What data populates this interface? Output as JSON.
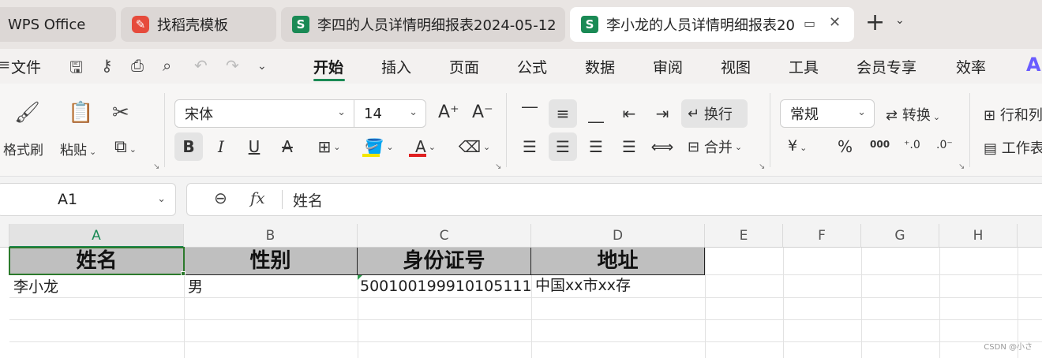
{
  "tabs": [
    {
      "label": "WPS Office",
      "icon": "wps-logo-icon",
      "active": false
    },
    {
      "label": "找稻壳模板",
      "icon": "daoke-icon",
      "active": false
    },
    {
      "label": "李四的人员详情明细报表2024-05-12",
      "icon": "spreadsheet-icon",
      "active": false
    },
    {
      "label": "李小龙的人员详情明细报表20",
      "icon": "spreadsheet-icon",
      "active": true
    }
  ],
  "menu": {
    "file": "文件",
    "items": [
      "开始",
      "插入",
      "页面",
      "公式",
      "数据",
      "审阅",
      "视图",
      "工具",
      "会员专享",
      "效率"
    ],
    "active": "开始"
  },
  "ribbon": {
    "format_painter": "格式刷",
    "paste": "粘贴",
    "font_name": "宋体",
    "font_size": "14",
    "wrap": "换行",
    "merge": "合并",
    "number_format": "常规",
    "convert": "转换",
    "rows_cols": "行和列",
    "worksheet": "工作表",
    "currency_symbol": "¥",
    "percent_symbol": "%",
    "thousands_symbol": "000",
    "font_color": "#e02020",
    "fill_color": "#f2e600",
    "accent": "#1a8a55"
  },
  "formula_bar": {
    "name_box": "A1",
    "fx_label": "fx",
    "value": "姓名"
  },
  "sheet": {
    "columns": [
      "A",
      "B",
      "C",
      "D",
      "E",
      "F",
      "G",
      "H"
    ],
    "header_row": [
      "姓名",
      "性别",
      "身份证号",
      "地址"
    ],
    "rows": [
      [
        "李小龙",
        "男",
        "500100199910105111",
        "中国xx市xx存"
      ]
    ]
  },
  "watermark": "CSDN @小さ"
}
